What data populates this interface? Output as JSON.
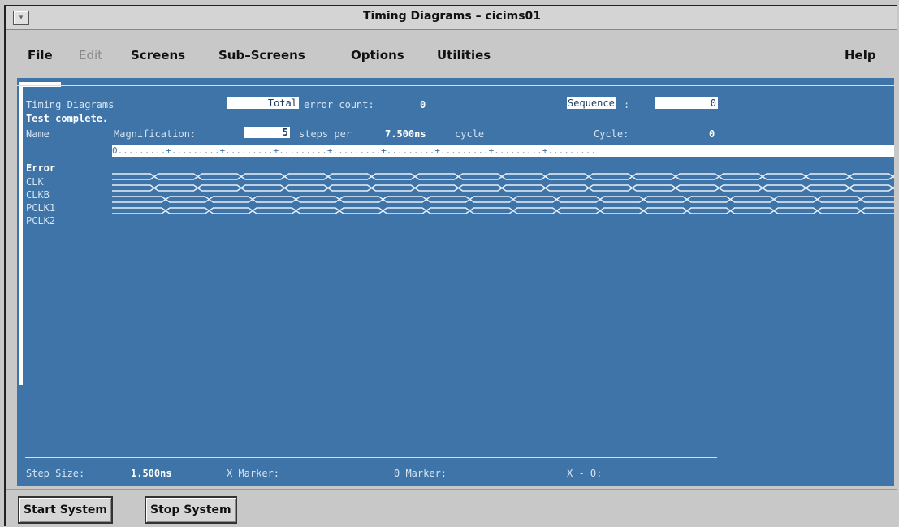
{
  "window": {
    "title": "Timing Diagrams – cicims01",
    "menu_icon": "window-menu-icon"
  },
  "menu": {
    "file": "File",
    "edit": "Edit",
    "screens": "Screens",
    "sub_screens": "Sub–Screens",
    "options": "Options",
    "utilities": "Utilities",
    "help": "Help"
  },
  "panel": {
    "heading": "Timing Diagrams",
    "total_label": "Total",
    "error_count_label": "error count:",
    "error_count_value": "0",
    "sequence_label": "Sequence",
    "sequence_colon": ":",
    "sequence_value": "0",
    "status": "Test complete.",
    "name_label": "Name",
    "magnification_label": "Magnification:",
    "magnification_value": "5",
    "steps_per_label": "steps per",
    "cycle_time": "7.500ns",
    "cycle_word": "cycle",
    "cycle_label": "Cycle:",
    "cycle_value": "0",
    "ruler": "0.........+.........+.........+.........+.........+.........+.........+.........+.........",
    "error_label": "Error",
    "signals": [
      "CLK",
      "CLKB",
      "PCLK1",
      "PCLK2"
    ]
  },
  "footer": {
    "step_size_label": "Step Size:",
    "step_size_value": "1.500ns",
    "x_marker_label": "X Marker:",
    "o_marker_label": "0 Marker:",
    "x_minus_o_label": "X - O:"
  },
  "buttons": {
    "start": "Start System",
    "stop": "Stop System"
  },
  "colors": {
    "panel_bg": "#3f74a8",
    "text": "#d6e4f2",
    "chrome": "#c8c8c8"
  }
}
